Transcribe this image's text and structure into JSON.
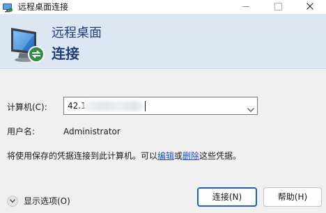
{
  "window": {
    "title": "远程桌面连接",
    "app_icon": "remote-desktop-icon",
    "controls": [
      "minimize-icon",
      "maximize-icon",
      "close-icon"
    ]
  },
  "banner": {
    "line1": "远程桌面",
    "line2": "连接",
    "icon": "monitor-connection-icon"
  },
  "form": {
    "computer_label": "计算机(C):",
    "computer_value": "42.1",
    "user_label": "用户名:",
    "user_value": "Administrator",
    "info_prefix": "将使用保存的凭据连接到此计算机。可以",
    "edit_link": "编辑",
    "info_middle": "或",
    "delete_link": "删除",
    "info_suffix": "这些凭据。"
  },
  "footer": {
    "options_label": "显示选项(O)",
    "options_icon": "chevron-down-icon",
    "connect_label": "连接(N)",
    "help_label": "帮助(H)"
  },
  "colors": {
    "banner_bg": "#dde6f3",
    "banner_text": "#1f3f74",
    "link": "#1a56c4",
    "primary_border": "#1f5fbf"
  }
}
